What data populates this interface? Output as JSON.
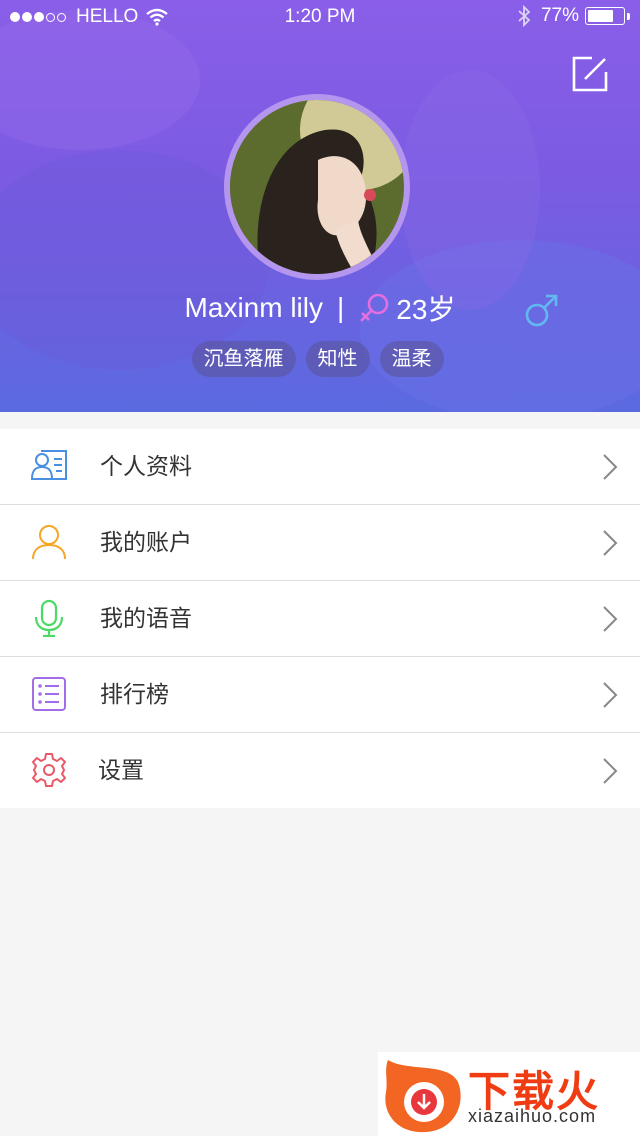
{
  "status_bar": {
    "carrier": "HELLO",
    "time": "1:20 PM",
    "battery_percent": "77%",
    "battery_level": 0.77
  },
  "header": {
    "gradient_top": "#8a5ee8",
    "gradient_bottom": "#5b6ae0",
    "edit_icon": "edit-icon"
  },
  "profile": {
    "name": "Maxinm lily",
    "separator": "|",
    "age": "23岁",
    "gender_icon": "female-icon",
    "tags": [
      "沉鱼落雁",
      "知性",
      "温柔"
    ]
  },
  "menu": {
    "items": [
      {
        "label": "个人资料",
        "icon": "profile-card-icon",
        "color": "#4a90e2"
      },
      {
        "label": "我的账户",
        "icon": "user-icon",
        "color": "#f5a623"
      },
      {
        "label": "我的语音",
        "icon": "microphone-icon",
        "color": "#4cd964"
      },
      {
        "label": "排行榜",
        "icon": "ranking-list-icon",
        "color": "#a26ee8"
      },
      {
        "label": "设置",
        "icon": "settings-gear-icon",
        "color": "#e85a6a"
      }
    ]
  },
  "watermark": {
    "title": "下载火",
    "url": "xiazaihuo.com"
  }
}
